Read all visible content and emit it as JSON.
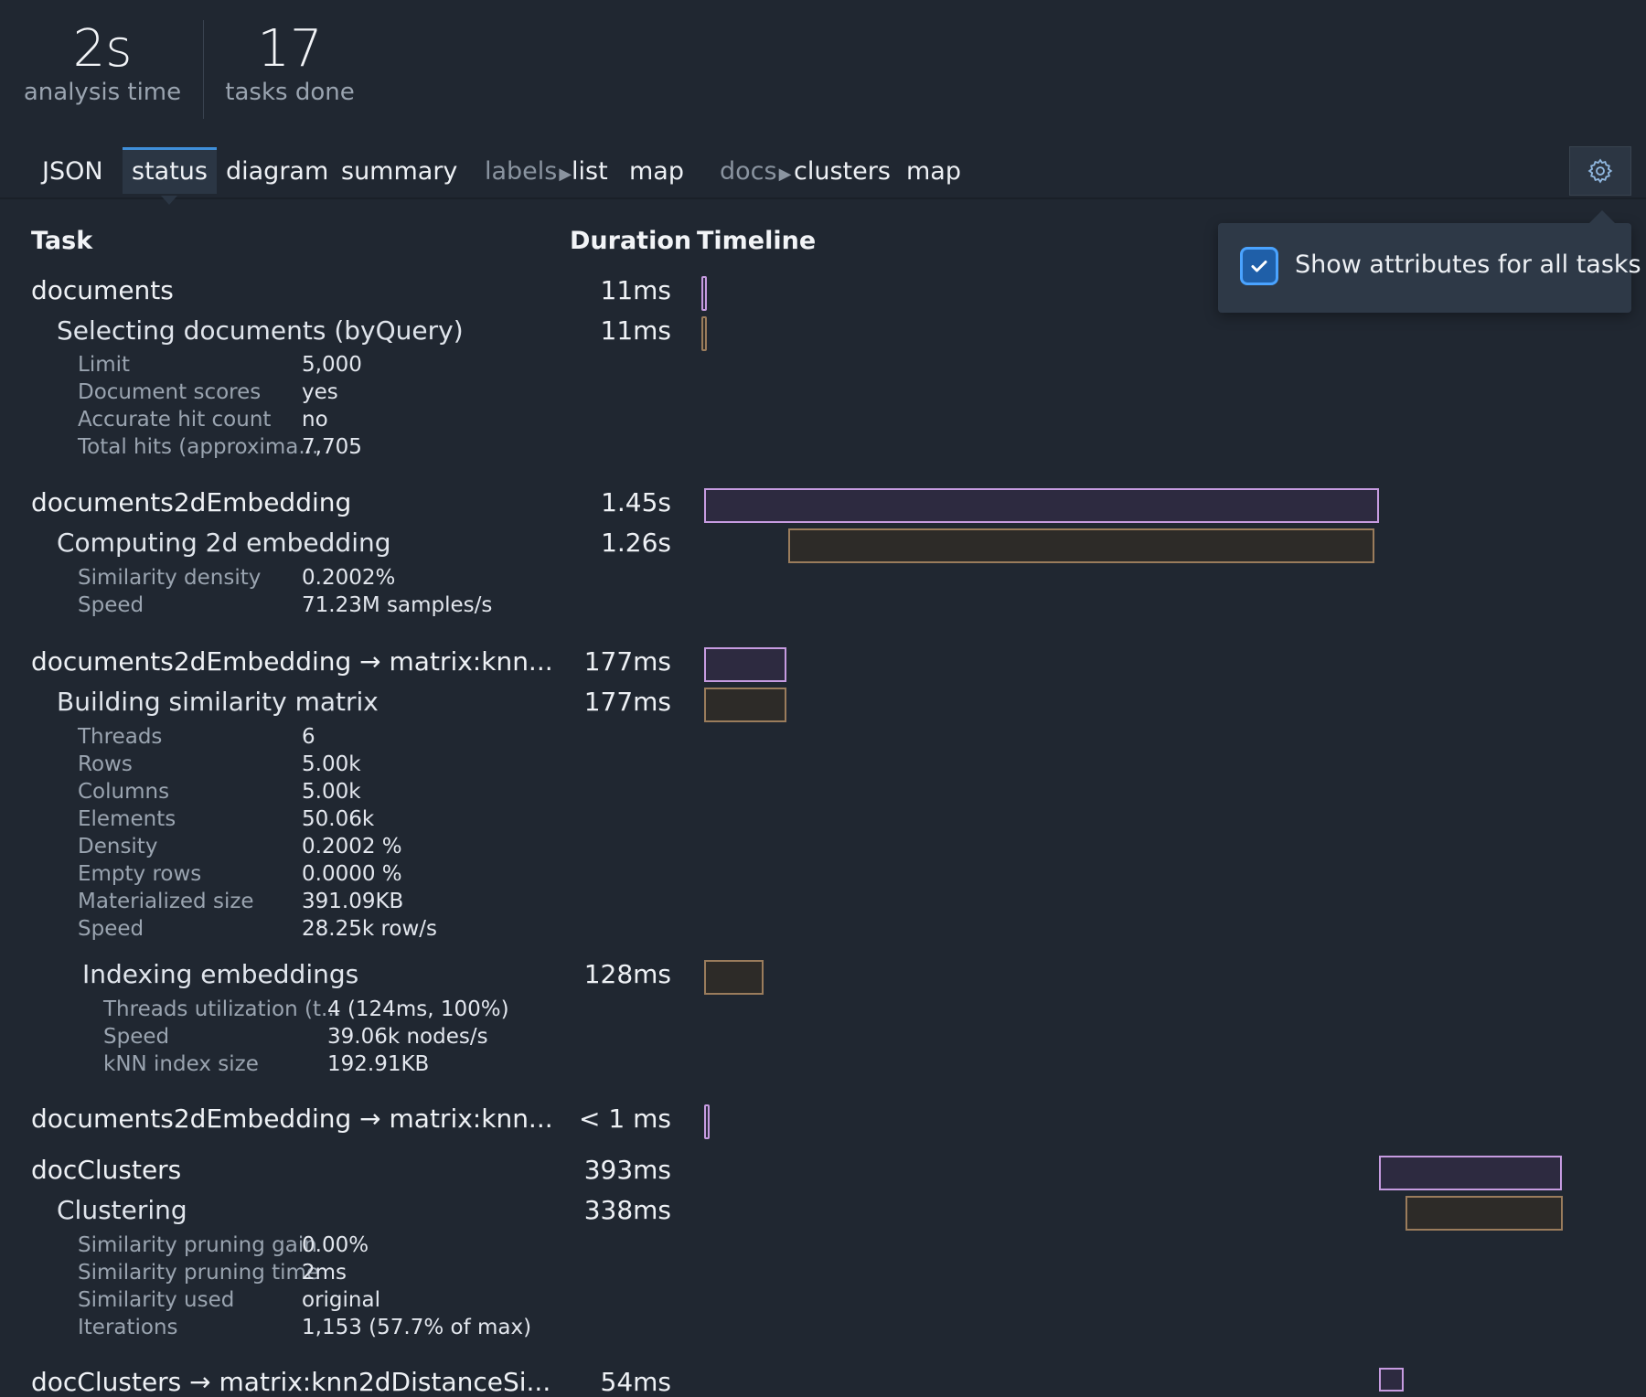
{
  "stats": {
    "time_value": "2s",
    "time_label": "analysis time",
    "tasks_value": "17",
    "tasks_label": "tasks done"
  },
  "tabs": {
    "json": "JSON",
    "status": "status",
    "diagram": "diagram",
    "summary": "summary",
    "labels_group": "labels",
    "labels_list": "list",
    "labels_map": "map",
    "docs_group": "docs",
    "docs_clusters": "clusters",
    "docs_map": "map"
  },
  "settings": {
    "gear_icon": "gear-icon",
    "show_attributes_label": "Show attributes for all tasks",
    "show_attributes_checked": true
  },
  "columns": {
    "task": "Task",
    "duration": "Duration",
    "timeline": "Timeline"
  },
  "tasks": [
    {
      "name": "documents",
      "duration": "11ms",
      "children": [
        {
          "name": "Selecting documents (byQuery)",
          "duration": "11ms",
          "attrs": [
            {
              "key": "Limit",
              "value": "5,000"
            },
            {
              "key": "Document scores",
              "value": "yes"
            },
            {
              "key": "Accurate hit count",
              "value": "no"
            },
            {
              "key": "Total hits (approxima...",
              "value": "7,705"
            }
          ]
        }
      ]
    },
    {
      "name": "documents2dEmbedding",
      "duration": "1.45s",
      "children": [
        {
          "name": "Computing 2d embedding",
          "duration": "1.26s",
          "attrs": [
            {
              "key": "Similarity density",
              "value": "0.2002%"
            },
            {
              "key": "Speed",
              "value": "71.23M samples/s"
            }
          ]
        }
      ]
    },
    {
      "name": "documents2dEmbedding → matrix:knn...",
      "duration": "177ms",
      "children": [
        {
          "name": "Building similarity matrix",
          "duration": "177ms",
          "attrs": [
            {
              "key": "Threads",
              "value": "6"
            },
            {
              "key": "Rows",
              "value": "5.00k"
            },
            {
              "key": "Columns",
              "value": "5.00k"
            },
            {
              "key": "Elements",
              "value": "50.06k"
            },
            {
              "key": "Density",
              "value": "0.2002 %"
            },
            {
              "key": "Empty rows",
              "value": "0.0000 %"
            },
            {
              "key": "Materialized size",
              "value": "391.09KB"
            },
            {
              "key": "Speed",
              "value": "28.25k row/s"
            }
          ],
          "children": [
            {
              "name": "Indexing embeddings",
              "duration": "128ms",
              "attrs": [
                {
                  "key": "Threads utilization (t...",
                  "value": "4 (124ms, 100%)"
                },
                {
                  "key": "Speed",
                  "value": "39.06k nodes/s"
                },
                {
                  "key": "kNN index size",
                  "value": "192.91KB"
                }
              ]
            }
          ]
        }
      ]
    },
    {
      "name": "documents2dEmbedding → matrix:knn...",
      "duration": "< 1 ms"
    },
    {
      "name": "docClusters",
      "duration": "393ms",
      "children": [
        {
          "name": "Clustering",
          "duration": "338ms",
          "attrs": [
            {
              "key": "Similarity pruning gain",
              "value": "0.00%"
            },
            {
              "key": "Similarity pruning time",
              "value": "2ms"
            },
            {
              "key": "Similarity used",
              "value": "original"
            },
            {
              "key": "Iterations",
              "value": "1,153 (57.7% of max)"
            }
          ]
        }
      ]
    },
    {
      "name": "docClusters → matrix:knn2dDistanceSi...",
      "duration": "54ms"
    }
  ],
  "timeline": {
    "total_seconds": 2.0,
    "bars": [
      {
        "task": "documents",
        "start_s": 0.0,
        "duration_s": 0.011
      },
      {
        "task": "Selecting documents (byQuery)",
        "start_s": 0.0,
        "duration_s": 0.011
      },
      {
        "task": "documents2dEmbedding",
        "start_s": 0.006,
        "duration_s": 1.45
      },
      {
        "task": "Computing 2d embedding",
        "start_s": 0.186,
        "duration_s": 1.26
      },
      {
        "task": "documents2dEmbedding → matrix:knn...",
        "start_s": 0.006,
        "duration_s": 0.177
      },
      {
        "task": "Building similarity matrix",
        "start_s": 0.006,
        "duration_s": 0.177
      },
      {
        "task": "Indexing embeddings",
        "start_s": 0.006,
        "duration_s": 0.128
      },
      {
        "task": "documents2dEmbedding → matrix:knn...",
        "start_s": 0.006,
        "duration_s": 0.0005
      },
      {
        "task": "docClusters",
        "start_s": 1.456,
        "duration_s": 0.393
      },
      {
        "task": "Clustering",
        "start_s": 1.512,
        "duration_s": 0.338
      },
      {
        "task": "docClusters → matrix:knn2dDistanceSi...",
        "start_s": 1.456,
        "duration_s": 0.054
      }
    ]
  },
  "colors": {
    "task_bar": "#c69be0",
    "subtask_bar": "#9a7c5c",
    "accent": "#3f8fd9"
  }
}
